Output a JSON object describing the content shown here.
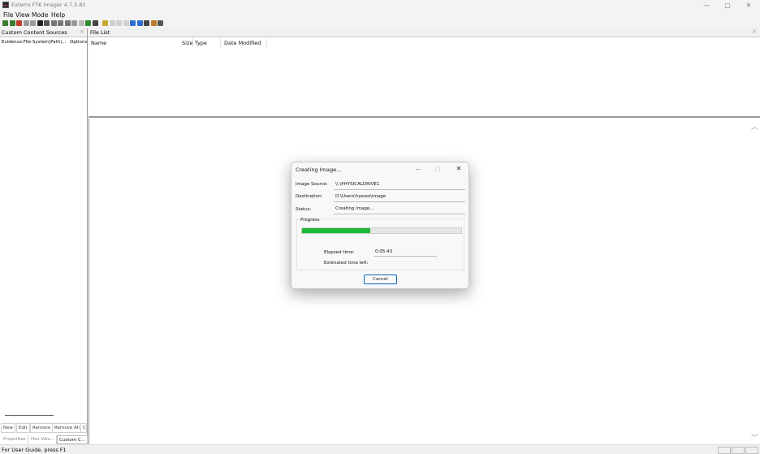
{
  "window": {
    "title": "Exterro FTK Imager 4.7.3.81",
    "minimize": "—",
    "maximize": "▢",
    "close": "✕"
  },
  "menu": {
    "items": [
      "File",
      "View",
      "Mode",
      "Help"
    ]
  },
  "toolbar": {
    "button_colors": [
      "#3a7d2c",
      "#3a7d2c",
      "#c03a2b",
      "#999",
      "#999",
      "#222",
      "#555",
      "#777",
      "#777",
      "#777",
      "#999",
      "#bbb",
      "#2d8a2d",
      "#444",
      "#c7a72c",
      "#d0d0d0",
      "#d0d0d0",
      "#d0d0d0",
      "#2f6fd0",
      "#2f6fd0",
      "#444",
      "#c07a2c",
      "#555"
    ]
  },
  "left_pane": {
    "title": "Custom Content Sources",
    "close": "×",
    "columns": {
      "evidence": "Evidence:File System|Path|...",
      "options": "Options"
    },
    "buttons": [
      "New",
      "Edit",
      "Remove",
      "Remove All",
      "C"
    ],
    "tabs": [
      "Properties",
      "Hex Valu...",
      "Custom C..."
    ]
  },
  "file_list": {
    "title": "File List",
    "close": "×",
    "columns": [
      "Name",
      "Size",
      "Type",
      "Date Modified"
    ]
  },
  "viewer": {
    "scroll_up": "︿",
    "scroll_down": "﹀"
  },
  "status_bar": {
    "text": "For User Guide, press F1"
  },
  "dialog": {
    "title": "Creating Image...",
    "minimize": "—",
    "maximize": "▢",
    "close": "✕",
    "image_source_label": "Image Source:",
    "image_source_value": "\\\\.\\PHYSICALDRIVE1",
    "destination_label": "Destination:",
    "destination_value": "D:\\Users\\hyewo\\image",
    "status_label": "Status:",
    "status_value": "Creating image...",
    "progress_label": "Progress",
    "progress_fraction": 0.43,
    "progress_color": "#1db835",
    "elapsed_label": "Elapsed time:",
    "elapsed_value": "0:05:43",
    "remaining_label": "Estimated time left:",
    "remaining_value": "",
    "cancel_label": "Cancel"
  }
}
